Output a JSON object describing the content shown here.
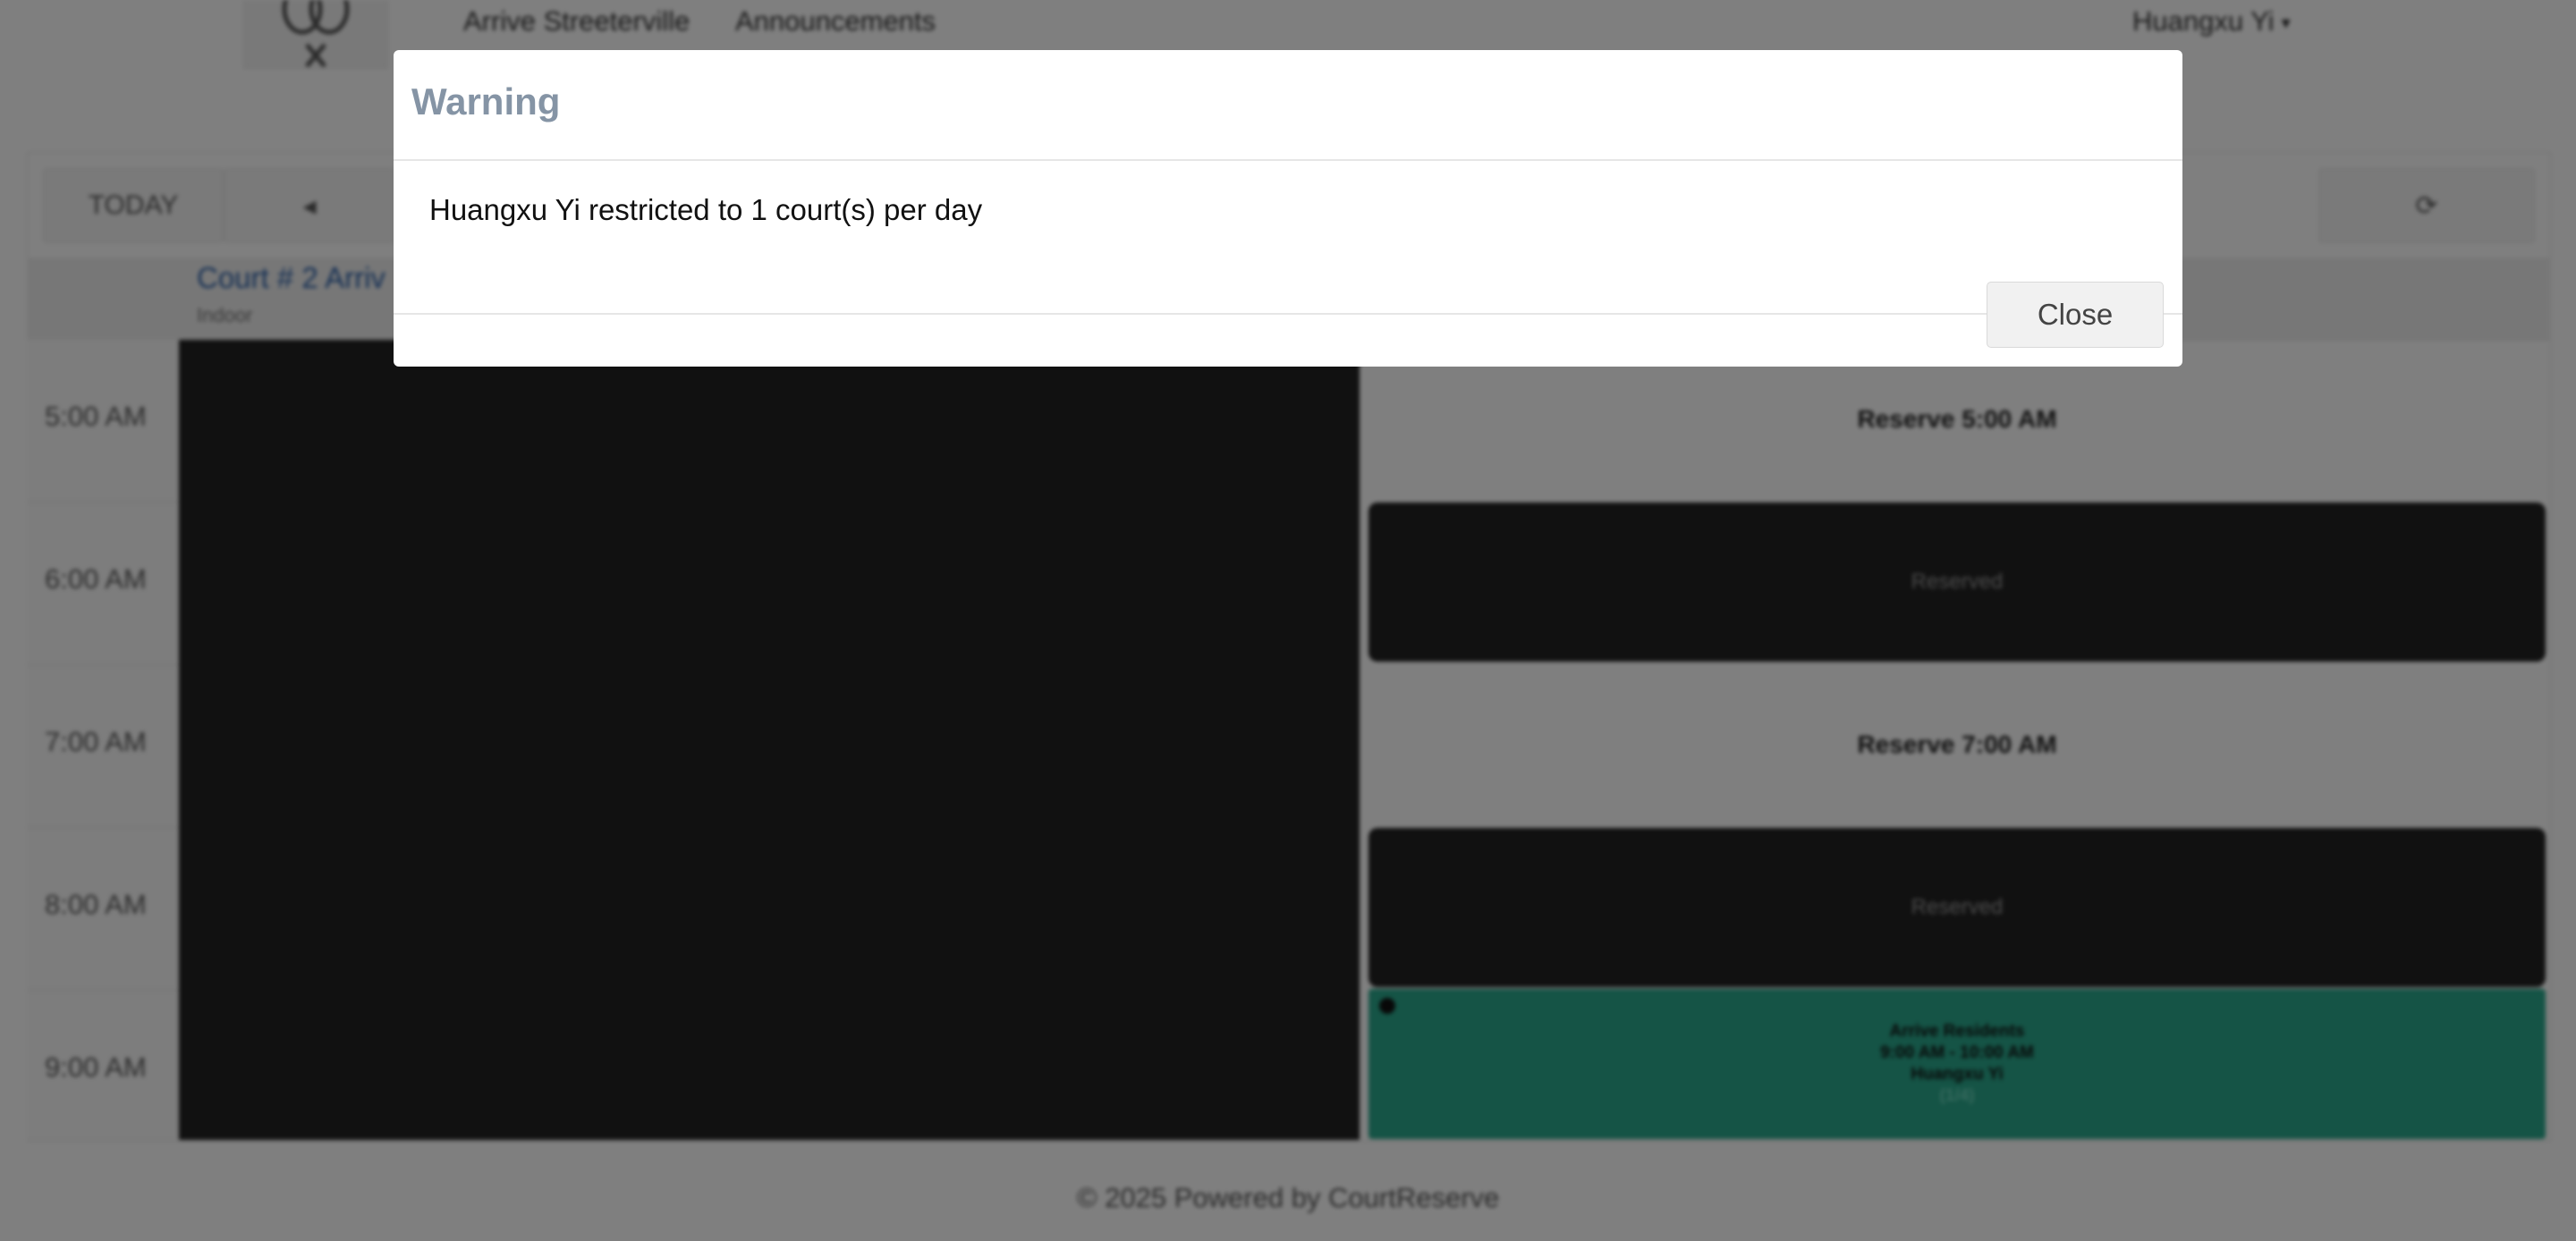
{
  "nav": {
    "links": [
      "Arrive Streeterville",
      "Announcements"
    ],
    "user_name": "Huangxu Yi",
    "user_caret": "▾"
  },
  "toolbar": {
    "today_label": "TODAY",
    "prev_icon": "◂",
    "refresh_icon": "⟳"
  },
  "court": {
    "title": "Court # 2 Arriv",
    "subtitle": "Indoor"
  },
  "schedule": {
    "times": [
      "5:00 AM",
      "6:00 AM",
      "7:00 AM",
      "8:00 AM",
      "9:00 AM"
    ],
    "slots": [
      {
        "label": "Reserve 5:00 AM",
        "kind": "open"
      },
      {
        "label": "Reserved",
        "kind": "reserved"
      },
      {
        "label": "Reserve 7:00 AM",
        "kind": "open"
      },
      {
        "label": "Reserved",
        "kind": "reserved"
      }
    ],
    "event": {
      "title": "Arrive Residents",
      "time_range": "9:00 AM - 10:00 AM",
      "owner": "Huangxu Yi",
      "extra": "(1/4)"
    }
  },
  "footer": {
    "text": "© 2025 Powered by CourtReserve"
  },
  "modal": {
    "title": "Warning",
    "message": "Huangxu Yi restricted to 1 court(s) per day",
    "close_label": "Close"
  }
}
